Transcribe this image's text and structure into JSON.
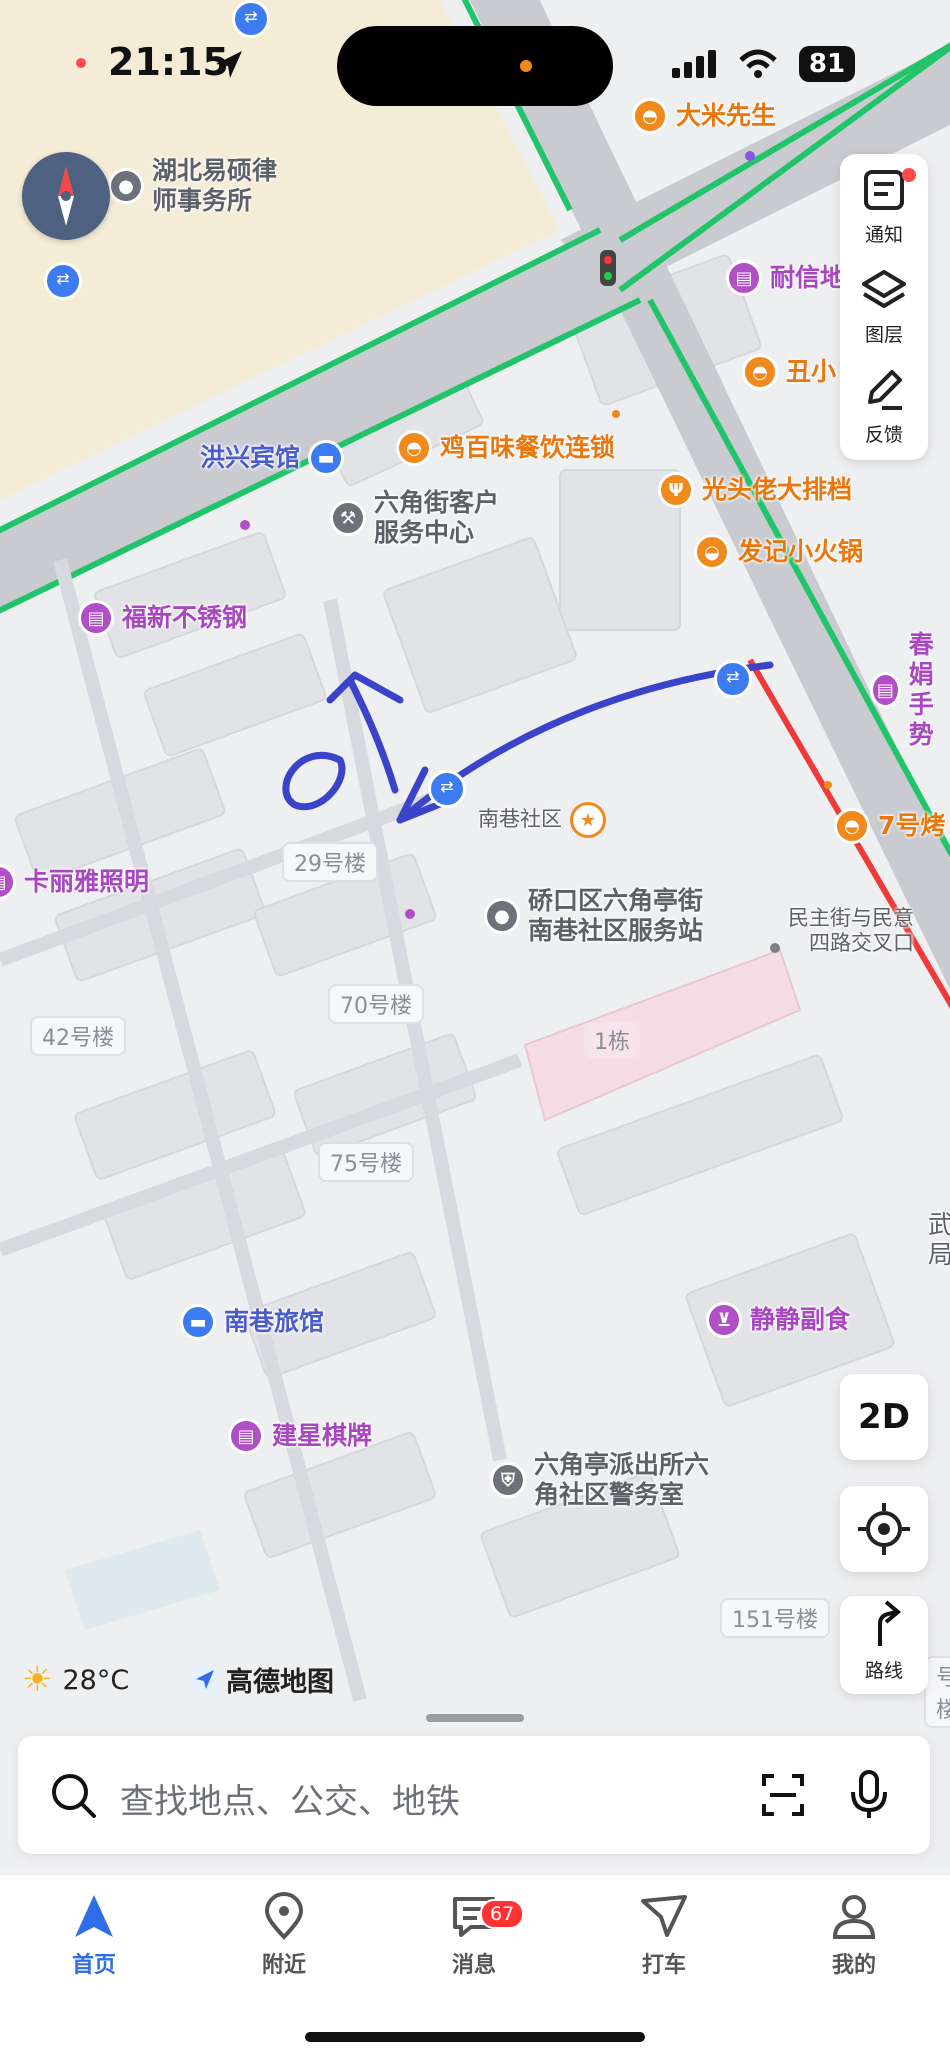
{
  "status": {
    "time": "21:15",
    "battery": "81"
  },
  "controls": {
    "notify": "通知",
    "layers": "图层",
    "feedback": "反馈",
    "mode": "2D",
    "route": "路线"
  },
  "map": {
    "pois": [
      {
        "key": "damixiansheng",
        "text": "大米先生",
        "color": "orange"
      },
      {
        "key": "yishuolv",
        "text": "湖北易硕律\n师事务所",
        "color": "gray"
      },
      {
        "key": "naixin",
        "text": "耐信地",
        "color": "purple"
      },
      {
        "key": "chouxiao",
        "text": "丑小",
        "color": "orange"
      },
      {
        "key": "jibaiwei",
        "text": "鸡百味餐饮连锁",
        "color": "orange"
      },
      {
        "key": "hongxing",
        "text": "洪兴宾馆",
        "color": "blue"
      },
      {
        "key": "liujiaojie",
        "text": "六角街客户\n服务中心",
        "color": "gray"
      },
      {
        "key": "guangtoulao",
        "text": "光头佬大排档",
        "color": "orange"
      },
      {
        "key": "fajixiaohuoguo",
        "text": "发记小火锅",
        "color": "orange"
      },
      {
        "key": "fuxin",
        "text": "福新不锈钢",
        "color": "purple"
      },
      {
        "key": "chunmei",
        "text": "春娟\n手势",
        "color": "purple"
      },
      {
        "key": "nanxiang",
        "text": "南巷社区",
        "color": "gray"
      },
      {
        "key": "qihao",
        "text": "7号烤",
        "color": "orange"
      },
      {
        "key": "kaliya",
        "text": "卡丽雅照明",
        "color": "purple"
      },
      {
        "key": "fuwuzhan",
        "text": "硚口区六角亭街\n南巷社区服务站",
        "color": "gray"
      },
      {
        "key": "minzhu",
        "text": "民主街与民意\n四路交叉口",
        "color": "gray"
      },
      {
        "key": "nanxianglvguan",
        "text": "南巷旅馆",
        "color": "blue"
      },
      {
        "key": "jingjing",
        "text": "静静副食",
        "color": "purple"
      },
      {
        "key": "jianxing",
        "text": "建星棋牌",
        "color": "purple"
      },
      {
        "key": "paichusuo",
        "text": "六角亭派出所六\n角社区警务室",
        "color": "gray"
      },
      {
        "key": "wu",
        "text": "武\n局",
        "color": "gray"
      }
    ],
    "buildings": [
      "29号楼",
      "70号楼",
      "42号楼",
      "1栋",
      "75号楼",
      "151号楼",
      "号楼"
    ]
  },
  "weather": {
    "temp": "28°C"
  },
  "brand": {
    "name": "高德地图"
  },
  "search": {
    "placeholder": "查找地点、公交、地铁"
  },
  "tabs": [
    {
      "label": "首页"
    },
    {
      "label": "附近"
    },
    {
      "label": "消息",
      "badge": "67"
    },
    {
      "label": "打车"
    },
    {
      "label": "我的"
    }
  ],
  "colors": {
    "accent": "#2f6ee8",
    "road_green": "#22c46a",
    "road_red": "#f03a3a",
    "poi_orange": "#f08a1c",
    "poi_purple": "#b04fc6",
    "annotation": "#3a43c9"
  }
}
